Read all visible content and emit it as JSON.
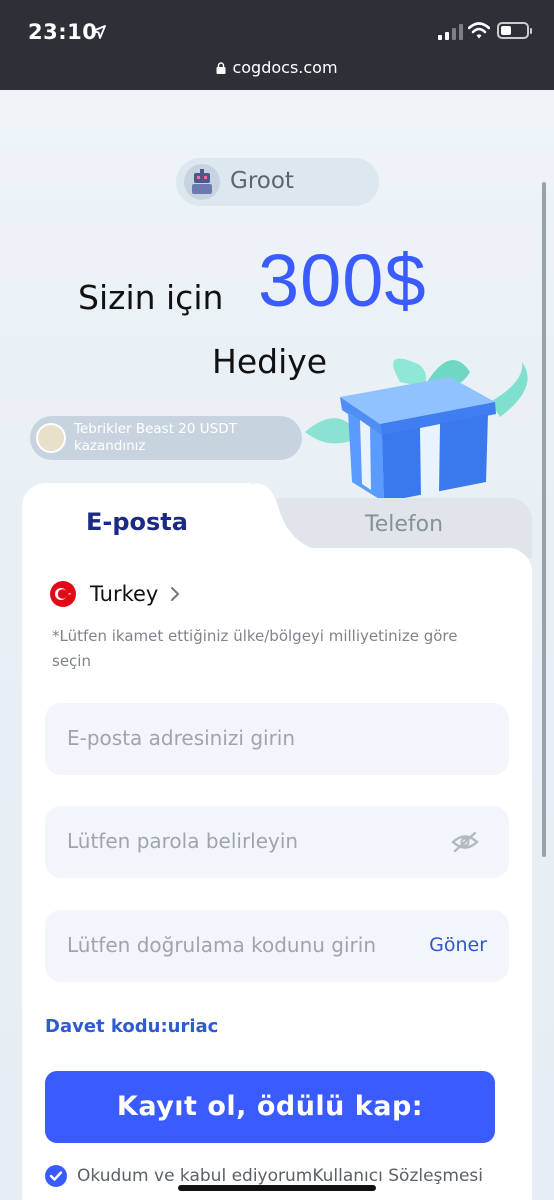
{
  "status": {
    "time": "23:10"
  },
  "browser": {
    "url": "cogdocs.com"
  },
  "user": {
    "name": "Groot"
  },
  "promo": {
    "line1": "Sizin için",
    "amount": "300$",
    "line2": "Hediye"
  },
  "ticker": {
    "text": "Tebrikler Beast 20 USDT kazandınız"
  },
  "tabs": [
    {
      "label": "E-posta",
      "active": true
    },
    {
      "label": "Telefon",
      "active": false
    }
  ],
  "country": {
    "name": "Turkey",
    "hint": "*Lütfen ikamet ettiğiniz ülke/bölgeyi milliyetinize göre seçin"
  },
  "form": {
    "email_placeholder": "E-posta adresinizi girin",
    "password_placeholder": "Lütfen parola belirleyin",
    "code_placeholder": "Lütfen doğrulama kodunu girin",
    "send_label": "Göner"
  },
  "invite": {
    "text": "Davet kodu:uriac"
  },
  "cta": {
    "label": "Kayıt ol, ödülü kap:"
  },
  "agreement": {
    "prefix": "Okudum ve kabul ediyorum",
    "link": "Kullanıcı Sözleşmesi"
  },
  "colors": {
    "accent": "#3a5bff",
    "topbar": "#2c3138",
    "tab_active": "#1b2a86",
    "link": "#2f5bd0"
  },
  "icons": [
    "location-arrow-icon",
    "signal-icon",
    "wifi-icon",
    "battery-icon",
    "lock-icon",
    "gift-box-icon",
    "flag-turkey-icon",
    "chevron-right-icon",
    "eye-off-icon",
    "checkmark-icon"
  ]
}
